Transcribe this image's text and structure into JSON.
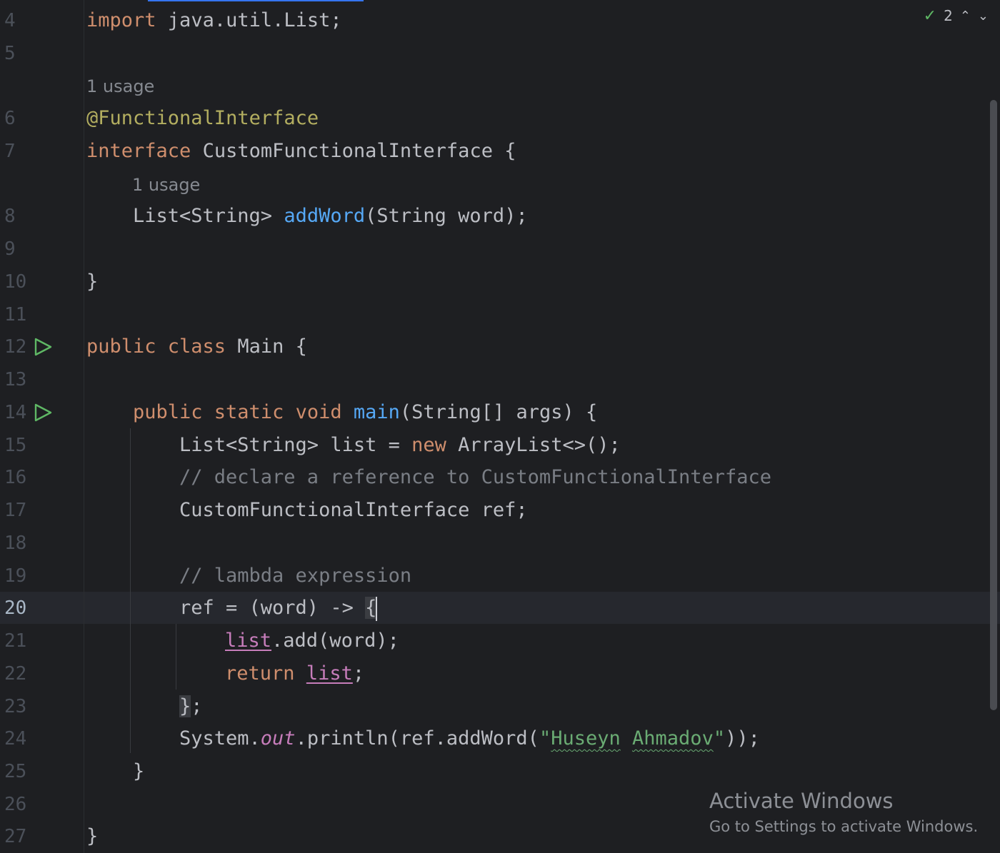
{
  "editor": {
    "inspection": {
      "count": "2",
      "check_icon": "check-icon",
      "prev_icon": "chevron-up-icon",
      "next_icon": "chevron-down-icon"
    },
    "lines": {
      "l4": {
        "num": "4",
        "import_kw": "import",
        "import_rest": " java.util.List;"
      },
      "l5": {
        "num": "5"
      },
      "hint1": "1 usage",
      "l6": {
        "num": "6",
        "annotation": "@FunctionalInterface"
      },
      "l7": {
        "num": "7",
        "interface_kw": "interface",
        "name": " CustomFunctionalInterface {"
      },
      "hint2": "1 usage",
      "l8": {
        "num": "8",
        "type": "List<String> ",
        "method": "addWord",
        "params": "(String word);"
      },
      "l9": {
        "num": "9"
      },
      "l10": {
        "num": "10",
        "text": "}"
      },
      "l11": {
        "num": "11"
      },
      "l12": {
        "num": "12",
        "kw": "public class",
        "rest": " Main {"
      },
      "l13": {
        "num": "13"
      },
      "l14": {
        "num": "14",
        "kw": "public static void",
        "sp": " ",
        "method": "main",
        "rest": "(String[] args) {"
      },
      "l15": {
        "num": "15",
        "a": "List<String> list = ",
        "kw": "new",
        "b": " ArrayList<>();"
      },
      "l16": {
        "num": "16",
        "comment": "// declare a reference to CustomFunctionalInterface"
      },
      "l17": {
        "num": "17",
        "text": "CustomFunctionalInterface ref;"
      },
      "l18": {
        "num": "18"
      },
      "l19": {
        "num": "19",
        "comment": "// lambda expression"
      },
      "l20": {
        "num": "20",
        "text": "ref = (word) -> ",
        "brace": "{"
      },
      "l21": {
        "num": "21",
        "var": "list",
        "rest": ".add(word);"
      },
      "l22": {
        "num": "22",
        "kw": "return",
        "sp": " ",
        "var": "list",
        "rest": ";"
      },
      "l23": {
        "num": "23",
        "brace": "}",
        "rest": ";"
      },
      "l24": {
        "num": "24",
        "a": "System.",
        "field": "out",
        "b": ".println(ref.addWord(",
        "q1": "\"",
        "w1": "Huseyn",
        "sp": " ",
        "w2": "Ahmadov",
        "q2": "\"",
        "c": "));"
      },
      "l25": {
        "num": "25",
        "text": "}"
      },
      "l26": {
        "num": "26"
      },
      "l27": {
        "num": "27",
        "text": "}"
      }
    }
  },
  "watermark": {
    "title": "Activate Windows",
    "subtitle": "Go to Settings to activate Windows."
  },
  "colors": {
    "background": "#1e1f22",
    "keyword": "#cf8e6d",
    "annotation": "#b3ae60",
    "method": "#56a8f5",
    "comment": "#7a7e85",
    "string": "#6aab73",
    "static_field": "#c77dbb"
  }
}
